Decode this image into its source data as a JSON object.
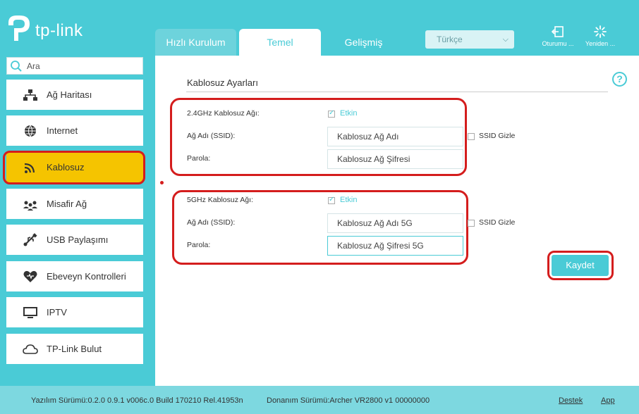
{
  "brand": {
    "logo_text": "tp-link"
  },
  "tabs": [
    {
      "label": "Hızlı Kurulum"
    },
    {
      "label": "Temel"
    },
    {
      "label": "Gelişmiş"
    }
  ],
  "language": {
    "selected": "Türkçe"
  },
  "header_buttons": {
    "logout": "Oturumu ...",
    "reboot": "Yeniden ..."
  },
  "search": {
    "placeholder": "Ara"
  },
  "sidebar": {
    "items": [
      {
        "label": "Ağ Haritası",
        "icon": "network-map-icon"
      },
      {
        "label": "Internet",
        "icon": "globe-icon"
      },
      {
        "label": "Kablosuz",
        "icon": "wifi-icon",
        "active": true
      },
      {
        "label": "Misafir Ağ",
        "icon": "guest-users-icon"
      },
      {
        "label": "USB Paylaşımı",
        "icon": "usb-icon"
      },
      {
        "label": "Ebeveyn Kontrolleri",
        "icon": "heart-icon"
      },
      {
        "label": "IPTV",
        "icon": "monitor-icon"
      },
      {
        "label": "TP-Link Bulut",
        "icon": "cloud-icon"
      }
    ]
  },
  "main": {
    "title": "Kablosuz Ayarları",
    "band24": {
      "label": "2.4GHz Kablosuz Ağı:",
      "enabled_text": "Etkin",
      "enabled": true,
      "ssid_label": "Ağ Adı (SSID):",
      "ssid_value": "Kablosuz Ağ Adı",
      "hide_ssid_label": "SSID Gizle",
      "password_label": "Parola:",
      "password_value": "Kablosuz Ağ Şifresi"
    },
    "band5": {
      "label": "5GHz Kablosuz Ağı:",
      "enabled_text": "Etkin",
      "enabled": true,
      "ssid_label": "Ağ Adı (SSID):",
      "ssid_value": "Kablosuz Ağ Adı 5G",
      "hide_ssid_label": "SSID Gizle",
      "password_label": "Parola:",
      "password_value": "Kablosuz Ağ Şifresi 5G"
    },
    "save_label": "Kaydet",
    "help_label": "?"
  },
  "footer": {
    "software": "Yazılım Sürümü:0.2.0 0.9.1 v006c.0 Build 170210 Rel.41953n",
    "hardware": "Donanım Sürümü:Archer VR2800 v1 00000000",
    "support": "Destek",
    "app": "App"
  },
  "colors": {
    "accent": "#4acbd6",
    "active_nav": "#f5c400",
    "annotation_red": "#d41d1d"
  }
}
